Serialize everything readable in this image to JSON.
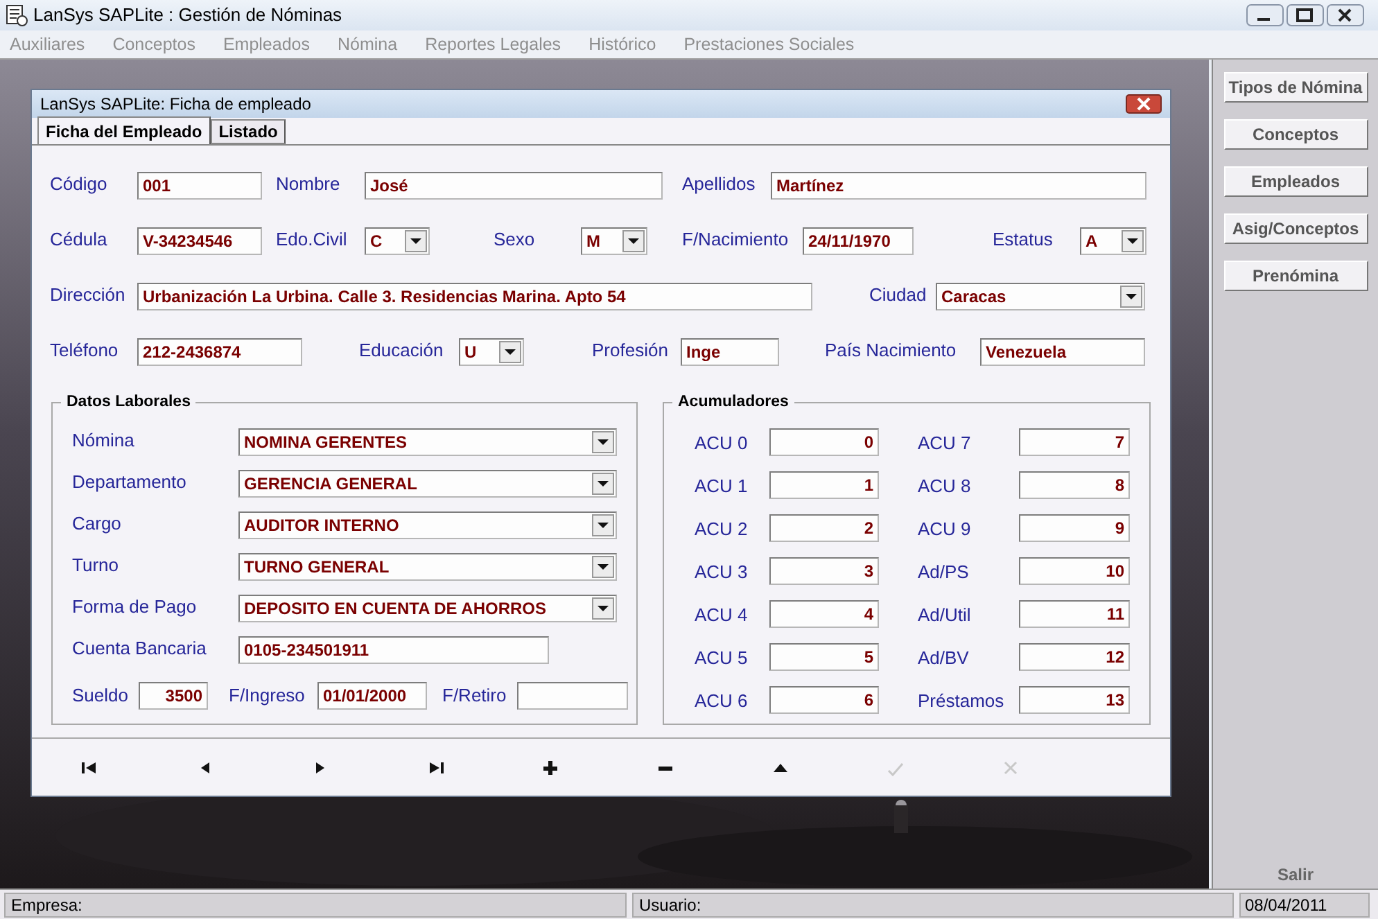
{
  "window": {
    "title": "LanSys SAPLite : Gestión de Nóminas"
  },
  "menu": [
    "Auxiliares",
    "Conceptos",
    "Empleados",
    "Nómina",
    "Reportes Legales",
    "Histórico",
    "Prestaciones Sociales"
  ],
  "dialog": {
    "title": "LanSys SAPLite: Ficha de empleado",
    "tabs": [
      {
        "label": "Ficha del Empleado",
        "selected": true
      },
      {
        "label": "Listado",
        "selected": false
      }
    ],
    "personal_rows": [
      [
        {
          "label": "Código",
          "value": "001",
          "kind": "text"
        },
        {
          "label": "Nombre",
          "value": "José",
          "kind": "text"
        },
        {
          "label": "Apellidos",
          "value": "Martínez",
          "kind": "text"
        }
      ],
      [
        {
          "label": "Cédula",
          "value": "V-34234546",
          "kind": "text"
        },
        {
          "label": "Edo.Civil",
          "value": "C",
          "kind": "combo"
        },
        {
          "label": "Sexo",
          "value": "M",
          "kind": "combo"
        },
        {
          "label": "F/Nacimiento",
          "value": "24/11/1970",
          "kind": "text"
        },
        {
          "label": "Estatus",
          "value": "A",
          "kind": "combo"
        }
      ],
      [
        {
          "label": "Dirección",
          "value": "Urbanización La Urbina. Calle 3. Residencias Marina. Apto 54",
          "kind": "text"
        },
        {
          "label": "Ciudad",
          "value": "Caracas",
          "kind": "combo"
        }
      ],
      [
        {
          "label": "Teléfono",
          "value": "212-2436874",
          "kind": "text"
        },
        {
          "label": "Educación",
          "value": "U",
          "kind": "combo"
        },
        {
          "label": "Profesión",
          "value": "Inge",
          "kind": "text"
        },
        {
          "label": "País Nacimiento",
          "value": "Venezuela",
          "kind": "text"
        }
      ]
    ],
    "datos_laborales": {
      "title": "Datos Laborales",
      "fields": [
        {
          "label": "Nómina",
          "value": "NOMINA GERENTES",
          "kind": "combo"
        },
        {
          "label": "Departamento",
          "value": "GERENCIA GENERAL",
          "kind": "combo"
        },
        {
          "label": "Cargo",
          "value": "AUDITOR INTERNO",
          "kind": "combo"
        },
        {
          "label": "Turno",
          "value": "TURNO GENERAL",
          "kind": "combo"
        },
        {
          "label": "Forma de Pago",
          "value": "DEPOSITO EN CUENTA DE AHORROS",
          "kind": "combo"
        },
        {
          "label": "Cuenta Bancaria",
          "value": "0105-234501911",
          "kind": "text"
        }
      ],
      "bottom_row": [
        {
          "label": "Sueldo",
          "value": "3500"
        },
        {
          "label": "F/Ingreso",
          "value": "01/01/2000"
        },
        {
          "label": "F/Retiro"
        }
      ]
    },
    "acumuladores": {
      "title": "Acumuladores",
      "column_1": [
        {
          "label": "ACU 0",
          "value": "0"
        },
        {
          "label": "ACU 1",
          "value": "1"
        },
        {
          "label": "ACU 2",
          "value": "2"
        },
        {
          "label": "ACU 3",
          "value": "3"
        },
        {
          "label": "ACU 4",
          "value": "4"
        },
        {
          "label": "ACU 5",
          "value": "5"
        },
        {
          "label": "ACU 6",
          "value": "6"
        }
      ],
      "column_2": [
        {
          "label": "ACU 7",
          "value": "7"
        },
        {
          "label": "ACU 8",
          "value": "8"
        },
        {
          "label": "ACU 9",
          "value": "9"
        },
        {
          "label": "Ad/PS",
          "value": "10"
        },
        {
          "label": "Ad/Util",
          "value": "11"
        },
        {
          "label": "Ad/BV",
          "value": "12"
        },
        {
          "label": "Préstamos",
          "value": "13"
        }
      ]
    },
    "navigator": [
      {
        "kind": "first",
        "disabled": false
      },
      {
        "kind": "prev",
        "disabled": false
      },
      {
        "kind": "next",
        "disabled": false
      },
      {
        "kind": "last",
        "disabled": false
      },
      {
        "kind": "add",
        "disabled": false
      },
      {
        "kind": "delete",
        "disabled": false
      },
      {
        "kind": "edit",
        "disabled": false
      },
      {
        "kind": "post",
        "disabled": true
      },
      {
        "kind": "cancel",
        "disabled": true
      }
    ]
  },
  "side_panel": {
    "buttons": [
      "Tipos de Nómina",
      "Conceptos",
      "Empleados",
      "Asig/Conceptos",
      "Prenómina"
    ],
    "exit": "Salir"
  },
  "status_bar": {
    "empresa": "Empresa:",
    "usuario": "Usuario:",
    "date": "08/04/2011"
  }
}
